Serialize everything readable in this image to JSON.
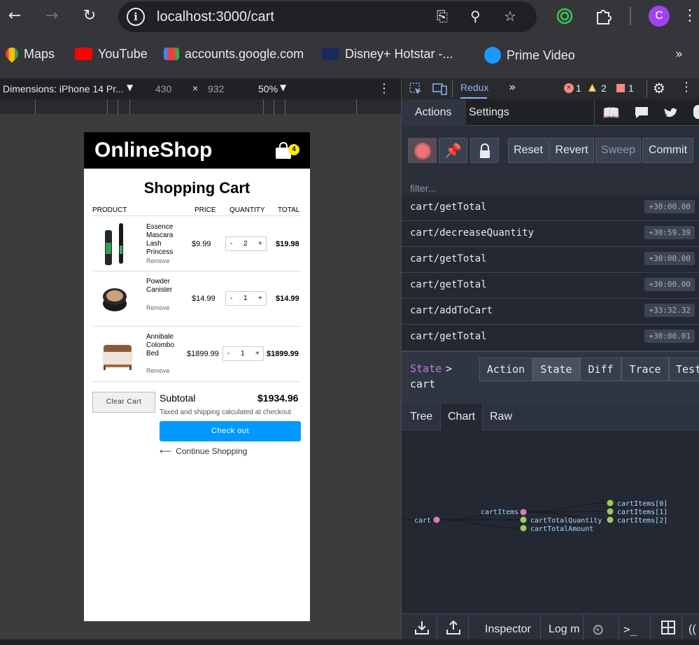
{
  "browser": {
    "url": "localhost:3000/cart",
    "profile_initial": "C",
    "bookmarks": [
      {
        "label": "Maps"
      },
      {
        "label": "YouTube"
      },
      {
        "label": "accounts.google.com"
      },
      {
        "label": "Disney+ Hotstar -..."
      },
      {
        "label": "Prime Video"
      }
    ]
  },
  "device_toolbar": {
    "device": "Dimensions: iPhone 14 Pr...",
    "width": "430",
    "times": "×",
    "height": "932",
    "zoom": "50%"
  },
  "shop": {
    "logo": "OnlineShop",
    "cart_count": "4",
    "title": "Shopping Cart",
    "columns": {
      "product": "PRODUCT",
      "price": "PRICE",
      "quantity": "QUANTITY",
      "total": "TOTAL"
    },
    "items": [
      {
        "name": "Essence Mascara Lash Princess",
        "remove": "Remove",
        "price": "$9.99",
        "qty": "2",
        "total": "$19.98"
      },
      {
        "name": "Powder Canister",
        "remove": "Remove",
        "price": "$14.99",
        "qty": "1",
        "total": "$14.99"
      },
      {
        "name": "Annibale Colombo Bed",
        "remove": "Remove",
        "price": "$1899.99",
        "qty": "1",
        "total": "$1899.99"
      }
    ],
    "minus": "-",
    "plus": "+",
    "clear_cart": "Clear Cart",
    "subtotal_label": "Subtotal",
    "subtotal_value": "$1934.96",
    "tax_note": "Taxed and shipping calculated at checkout",
    "checkout": "Check out",
    "continue": "Continue Shopping"
  },
  "devtools": {
    "panel_tab": "Redux",
    "errors": "1",
    "warnings": "2",
    "issues": "1",
    "tabs": [
      "Actions",
      "Settings"
    ],
    "buttons": [
      "Reset",
      "Revert",
      "Sweep",
      "Commit"
    ],
    "filter_placeholder": "filter...",
    "actions": [
      {
        "name": "cart/getTotal",
        "time": "+30:00.00"
      },
      {
        "name": "cart/decreaseQuantity",
        "time": "+30:59.39"
      },
      {
        "name": "cart/getTotal",
        "time": "+30:00.00"
      },
      {
        "name": "cart/getTotal",
        "time": "+30:00.00"
      },
      {
        "name": "cart/addToCart",
        "time": "+33:32.32"
      },
      {
        "name": "cart/getTotal",
        "time": "+30:00.01"
      }
    ],
    "state_path": "State",
    "state_sep": ">",
    "state_node": "cart",
    "inspector_tabs": [
      "Action",
      "State",
      "Diff",
      "Trace",
      "Test"
    ],
    "view_tabs": [
      "Tree",
      "Chart",
      "Raw"
    ],
    "chart_nodes": [
      "cart",
      "cartItems",
      "cartTotalQuantity",
      "cartTotalAmount",
      "cartItems[0]",
      "cartItems[1]",
      "cartItems[2]"
    ],
    "bottom": {
      "inspector": "Inspector",
      "log": "Log m"
    }
  }
}
